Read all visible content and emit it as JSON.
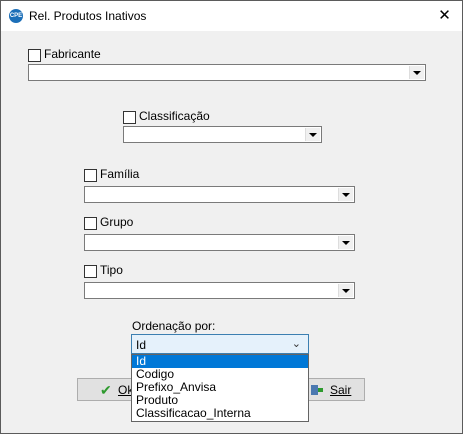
{
  "window": {
    "title": "Rel. Produtos Inativos",
    "close": "✕",
    "icon_text": "CPE"
  },
  "filters": {
    "fabricante": "Fabricante",
    "classificacao": "Classificação",
    "familia": "Família",
    "grupo": "Grupo",
    "tipo": "Tipo"
  },
  "ordenacao": {
    "label": "Ordenação por:",
    "selected": "Id",
    "options": [
      "Id",
      "Codigo",
      "Prefixo_Anvisa",
      "Produto",
      "Classificacao_Interna"
    ]
  },
  "buttons": {
    "ok": "Ok",
    "sair": "Sair"
  }
}
